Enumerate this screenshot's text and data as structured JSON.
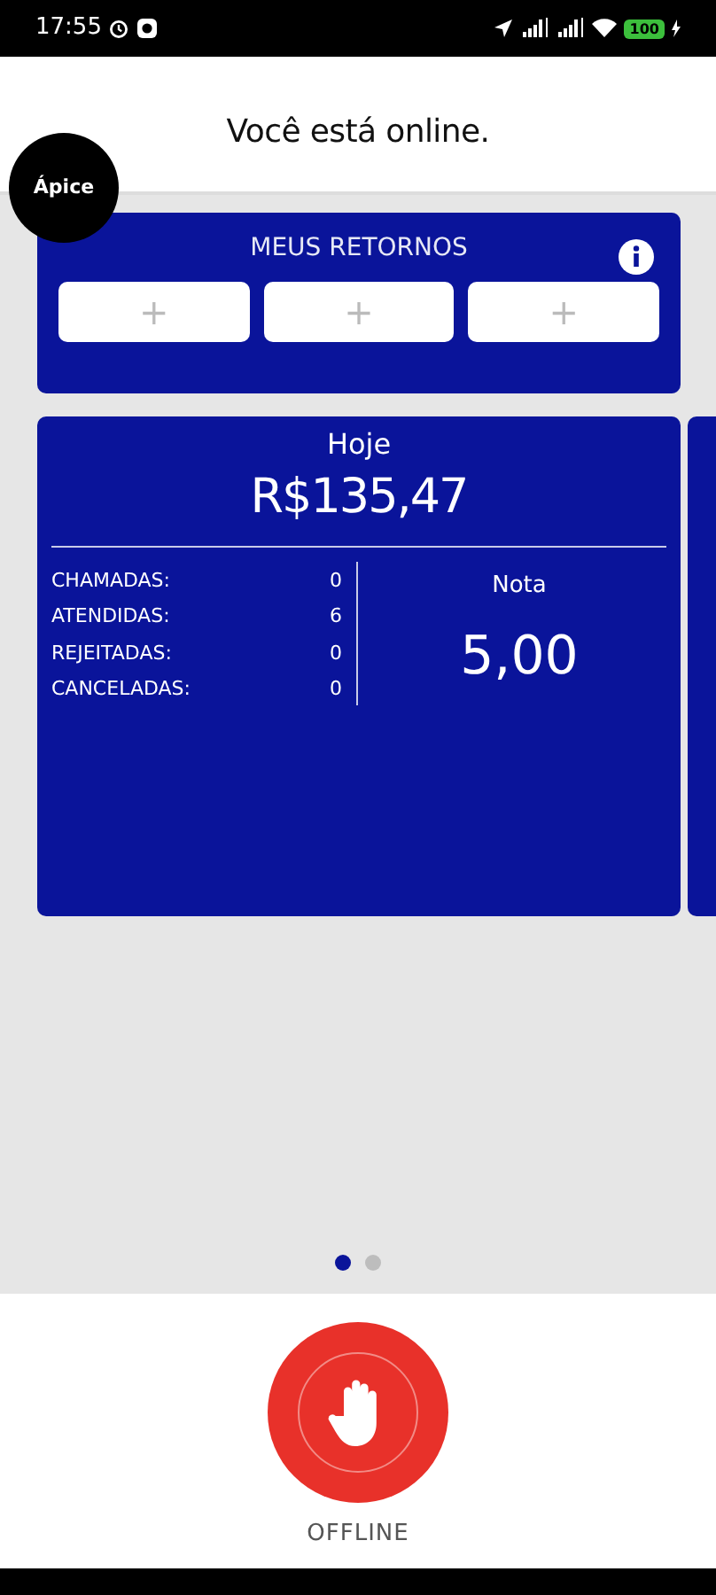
{
  "status_bar": {
    "time": "17:55",
    "battery": "100"
  },
  "header": {
    "title": "Você está online.",
    "logo": "Ápice"
  },
  "returns": {
    "title": "MEUS RETORNOS",
    "slots": [
      "+",
      "+",
      "+"
    ]
  },
  "summary": {
    "period": "Hoje",
    "amount": "R$135,47",
    "stats": [
      {
        "label": "CHAMADAS:",
        "value": "0"
      },
      {
        "label": "ATENDIDAS:",
        "value": "6"
      },
      {
        "label": "REJEITADAS:",
        "value": "0"
      },
      {
        "label": "CANCELADAS:",
        "value": "0"
      }
    ],
    "rating_label": "Nota",
    "rating": "5,00"
  },
  "pager": [
    {
      "selected": true
    },
    {
      "selected": false
    }
  ],
  "offline_button": {
    "label": "OFFLINE"
  }
}
